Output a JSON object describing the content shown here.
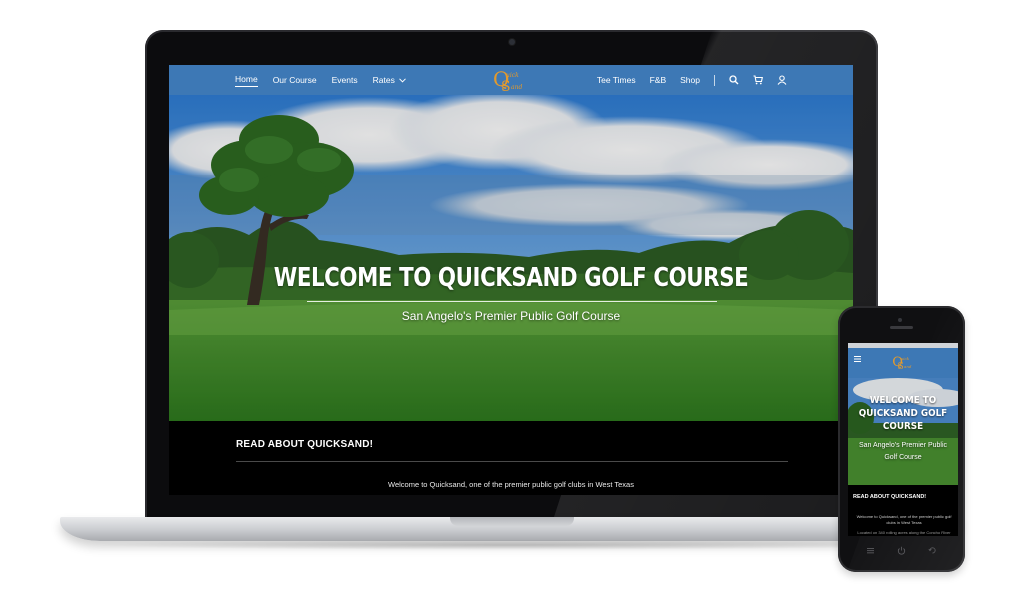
{
  "site": {
    "nav_left": [
      "Home",
      "Our Course",
      "Events",
      "Rates"
    ],
    "nav_right": [
      "Tee Times",
      "F&B",
      "Shop"
    ],
    "logo_text": "Quick Sand",
    "hero_title": "WELCOME TO QUICKSAND GOLF COURSE",
    "hero_subtitle": "San Angelo's Premier Public Golf Course",
    "read_heading": "READ ABOUT QUICKSAND!",
    "read_text": "Welcome to Quicksand, one of the premier public golf clubs in West Texas"
  },
  "mobile": {
    "title_line1": "WELCOME TO",
    "title_line2": "QUICKSAND GOLF",
    "title_line3": "COURSE",
    "subtitle_line1": "San Angelo's Premier Public",
    "subtitle_line2": "Golf Course",
    "read_heading": "READ ABOUT QUICKSAND!",
    "read_text": "Welcome to Quicksand, one of the premier public golf clubs in West Texas",
    "read_text_2": "Located on 340 rolling acres along the Concho River"
  },
  "colors": {
    "nav_blue": "#3d78b5",
    "logo_orange": "#e39a2d"
  },
  "icons": [
    "search-icon",
    "cart-icon",
    "user-icon",
    "chevron-down-icon",
    "menu-icon"
  ]
}
